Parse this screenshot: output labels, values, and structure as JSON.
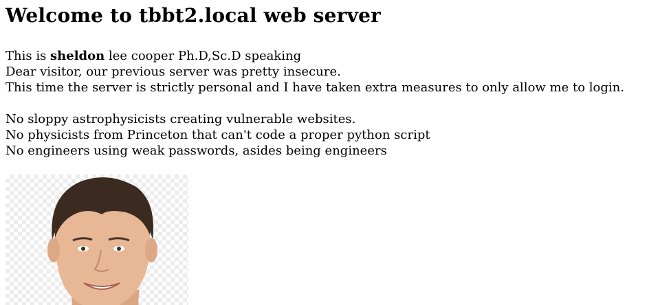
{
  "heading": "Welcome to tbbt2.local web server",
  "intro": {
    "prefix": "This is ",
    "name": "sheldon",
    "suffix": " lee cooper Ph.D,Sc.D speaking",
    "line2": "Dear visitor, our previous server was pretty insecure.",
    "line3": "This time the server is strictly personal and I have taken extra measures to only allow me to login."
  },
  "rules": [
    "No sloppy astrophysicists creating vulnerable websites.",
    "No physicists from Princeton that can't code a proper python script",
    "No engineers using weak passwords, asides being engineers"
  ],
  "colors": {
    "text": "#000000",
    "background": "#ffffff",
    "skin": "#e7b796",
    "hair": "#3a2a1f"
  }
}
